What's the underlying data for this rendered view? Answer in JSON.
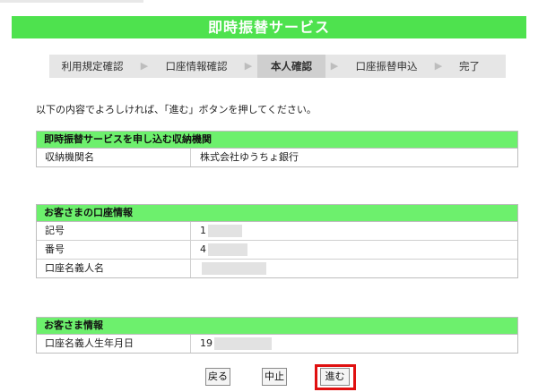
{
  "header": {
    "title": "即時振替サービス"
  },
  "steps": [
    {
      "label": "利用規定確認",
      "active": false
    },
    {
      "label": "口座情報確認",
      "active": false
    },
    {
      "label": "本人確認",
      "active": true
    },
    {
      "label": "口座振替申込",
      "active": false
    },
    {
      "label": "完了",
      "active": false
    }
  ],
  "intro": "以下の内容でよろしければ、「進む」ボタンを押してください。",
  "sections": {
    "institution": {
      "heading": "即時振替サービスを申し込む収納機関",
      "rows": [
        {
          "label": "収納機関名",
          "value": "株式会社ゆうちょ銀行"
        }
      ]
    },
    "account": {
      "heading": "お客さまの口座情報",
      "rows": [
        {
          "label": "記号",
          "value": "1"
        },
        {
          "label": "番号",
          "value": "4"
        },
        {
          "label": "口座名義人名",
          "value": ""
        }
      ]
    },
    "customer": {
      "heading": "お客さま情報",
      "rows": [
        {
          "label": "口座名義人生年月日",
          "value": "19"
        }
      ]
    }
  },
  "buttons": {
    "back": "戻る",
    "cancel": "中止",
    "next": "進む"
  },
  "colors": {
    "title_bar": "#4ee24e",
    "section_header": "#6df06d",
    "highlight": "#e01010"
  }
}
